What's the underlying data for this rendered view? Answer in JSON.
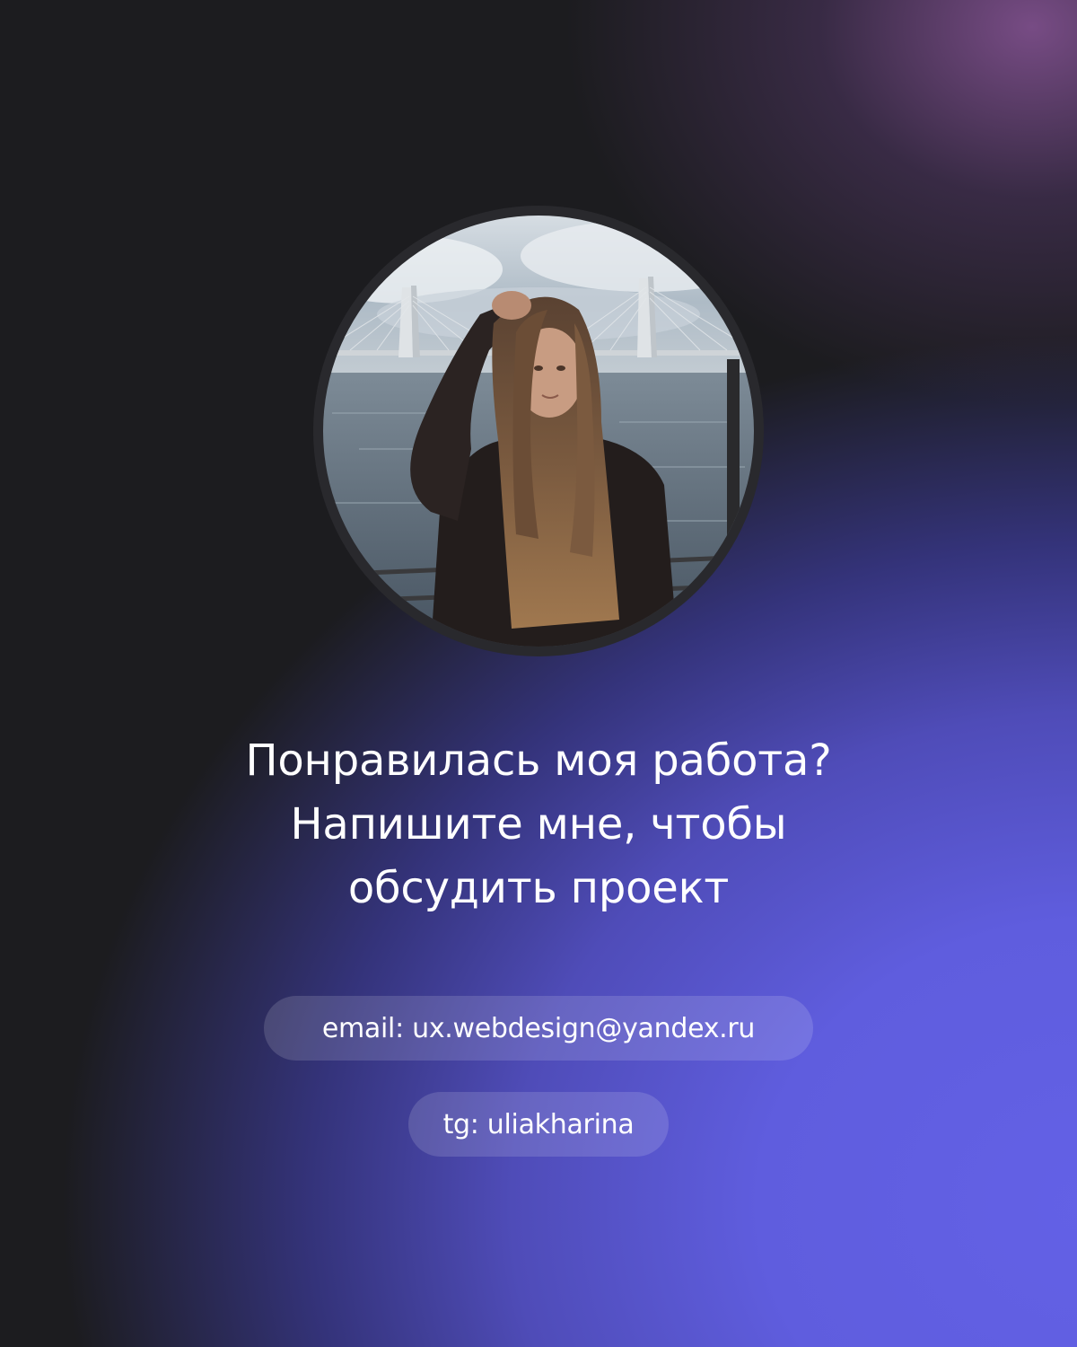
{
  "profile": {
    "photo_alt": "Фото"
  },
  "headline": {
    "line1": "Понравилась моя работа?",
    "line2": "Напишите мне, чтобы",
    "line3": "обсудить проект"
  },
  "contacts": {
    "email_text": "email: ux.webdesign@yandex.ru",
    "telegram_text": "tg: uliakharina"
  },
  "colors": {
    "background_dark": "#1c1c1f",
    "accent_violet": "#6361e6",
    "accent_pink": "#875496",
    "avatar_ring": "#29292d",
    "text": "#ffffff"
  }
}
